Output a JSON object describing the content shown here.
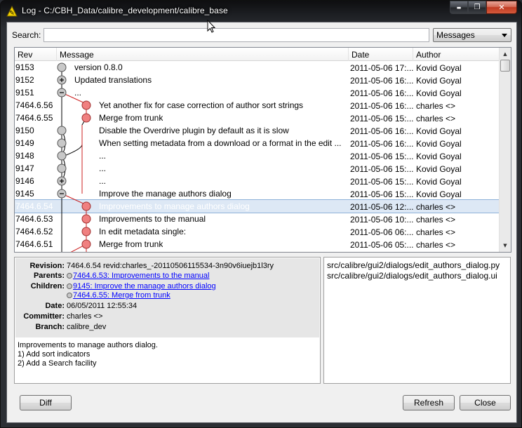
{
  "window": {
    "title": "Log - C:/CBH_Data/calibre_development/calibre_base",
    "controls": {
      "minimize": "▬",
      "maximize": "❐",
      "close": "✕"
    }
  },
  "search": {
    "label": "Search:",
    "value": "",
    "mode": "Messages"
  },
  "log": {
    "columns": [
      "Rev",
      "Message",
      "Date",
      "Author"
    ],
    "rows": [
      {
        "rev": "9153",
        "node": "collapsed",
        "message": "version 0.8.0",
        "date": "2011-05-06 17:...",
        "author": "Kovid Goyal"
      },
      {
        "rev": "9152",
        "node": "plus",
        "message": "Updated translations",
        "date": "2011-05-06 16:...",
        "author": "Kovid Goyal"
      },
      {
        "rev": "9151",
        "node": "minus",
        "message": "...",
        "date": "2011-05-06 16:...",
        "author": "Kovid Goyal"
      },
      {
        "rev": "7464.6.56",
        "node": "branch",
        "message": "Yet another fix for case correction of author sort strings",
        "date": "2011-05-06 16:...",
        "author": "charles <>"
      },
      {
        "rev": "7464.6.55",
        "node": "branch",
        "message": "Merge from trunk",
        "date": "2011-05-06 15:...",
        "author": "charles <>"
      },
      {
        "rev": "9150",
        "node": "trunk",
        "message": "Disable the Overdrive plugin by default as it is slow",
        "date": "2011-05-06 16:...",
        "author": "Kovid Goyal"
      },
      {
        "rev": "9149",
        "node": "trunk",
        "message": "When setting metadata from a download or a format in the edit ...",
        "date": "2011-05-06 16:...",
        "author": "Kovid Goyal"
      },
      {
        "rev": "9148",
        "node": "trunk",
        "message": "...",
        "date": "2011-05-06 15:...",
        "author": "Kovid Goyal"
      },
      {
        "rev": "9147",
        "node": "trunk",
        "message": "...",
        "date": "2011-05-06 15:...",
        "author": "Kovid Goyal"
      },
      {
        "rev": "9146",
        "node": "plus",
        "message": "...",
        "date": "2011-05-06 15:...",
        "author": "Kovid Goyal"
      },
      {
        "rev": "9145",
        "node": "minus",
        "message": "Improve the manage authors dialog",
        "date": "2011-05-06 15:...",
        "author": "Kovid Goyal"
      },
      {
        "rev": "7464.6.54",
        "node": "branch",
        "message": "Improvements to manage authors dialog",
        "date": "2011-05-06 12:...",
        "author": "charles <>",
        "selected": true
      },
      {
        "rev": "7464.6.53",
        "node": "branch",
        "message": "Improvements to the manual",
        "date": "2011-05-06 10:...",
        "author": "charles <>"
      },
      {
        "rev": "7464.6.52",
        "node": "branch",
        "message": "In edit metadata single:",
        "date": "2011-05-06 06:...",
        "author": "charles <>"
      },
      {
        "rev": "7464.6.51",
        "node": "branch",
        "message": "Merge from trunk",
        "date": "2011-05-06 05:...",
        "author": "charles <>"
      }
    ]
  },
  "details": {
    "labels": {
      "revision": "Revision:",
      "parents": "Parents:",
      "children": "Children:",
      "date": "Date:",
      "committer": "Committer:",
      "branch": "Branch:"
    },
    "revision": "7464.6.54 revid:charles_-20110506115534-3n90v6iuejb1l3ry",
    "parents": [
      "7464.6.53: Improvements to the manual"
    ],
    "children": [
      "9145: Improve the manage authors dialog",
      "7464.6.55: Merge from trunk"
    ],
    "date": "06/05/2011 12:55:34",
    "committer": "charles <>",
    "branch": "calibre_dev",
    "message_lines": [
      "Improvements to manage authors dialog.",
      "1) Add sort indicators",
      "2) Add a Search facility"
    ]
  },
  "files": [
    "src/calibre/gui2/dialogs/edit_authors_dialog.py",
    "src/calibre/gui2/dialogs/edit_authors_dialog.ui"
  ],
  "buttons": {
    "diff": "Diff",
    "refresh": "Refresh",
    "close": "Close"
  },
  "colors": {
    "branch_node": "#f08080",
    "branch_line": "#cc2020",
    "trunk_node": "#c8c8c8",
    "selection": "#dde8f5",
    "link": "#0000ff"
  }
}
